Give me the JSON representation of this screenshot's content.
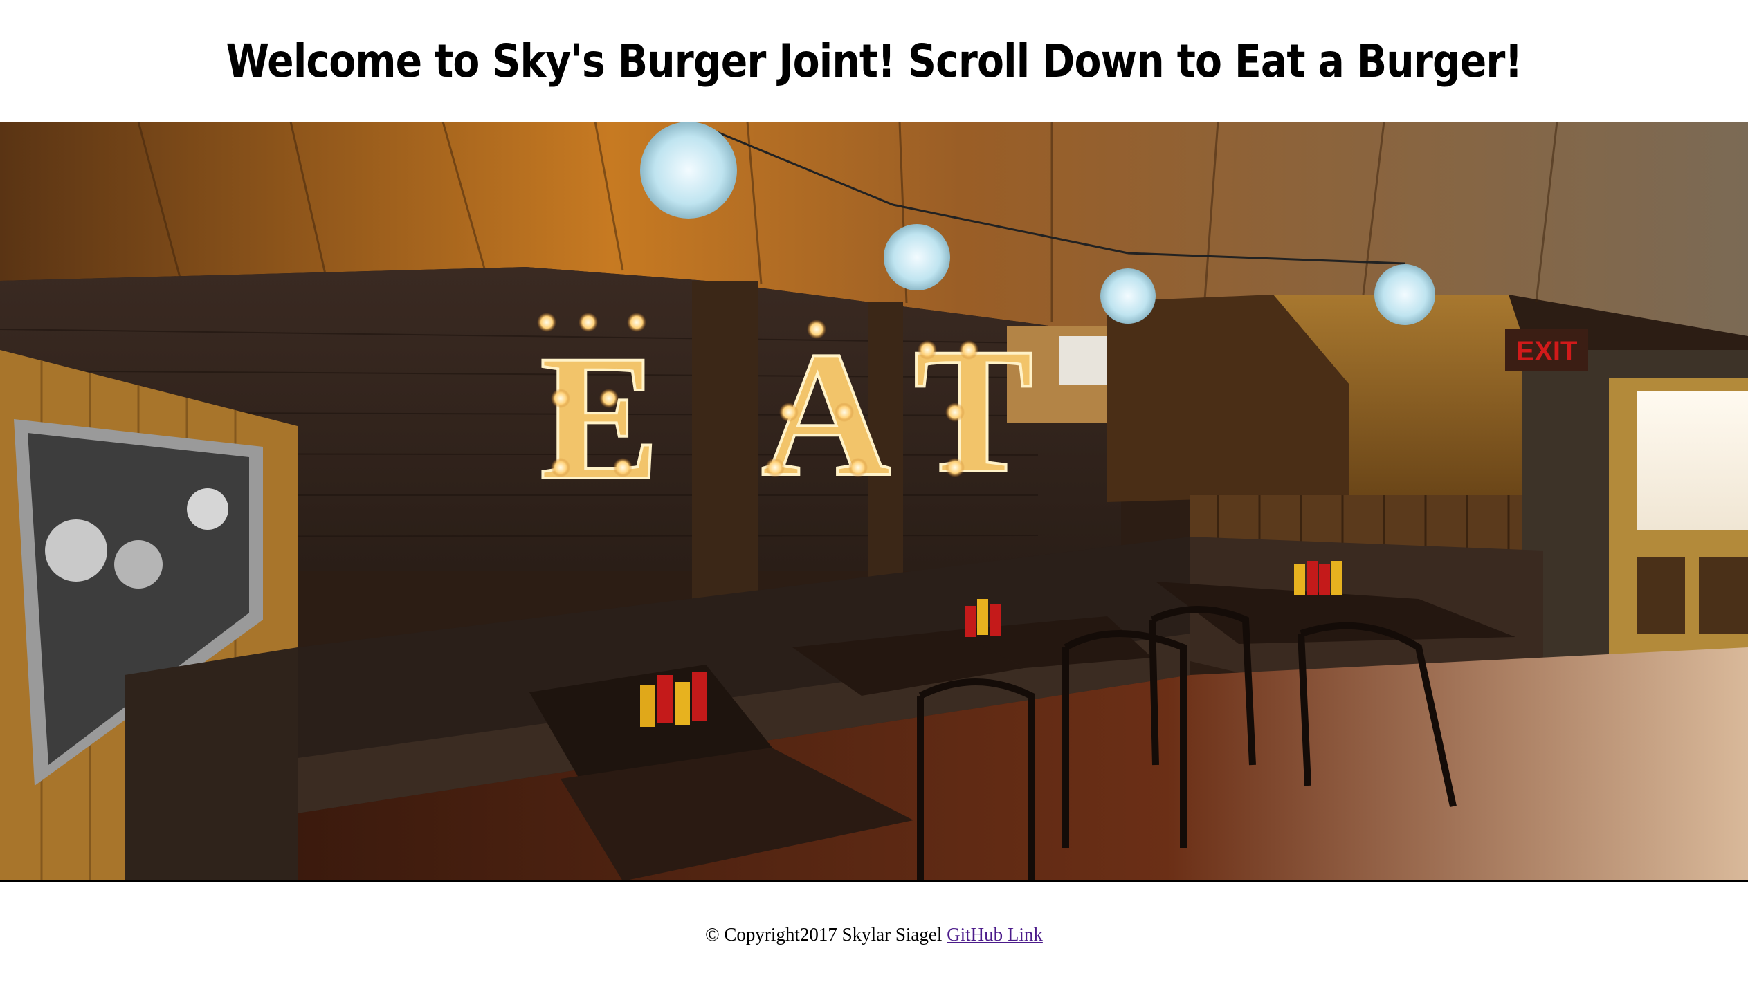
{
  "header": {
    "title": "Welcome to Sky's Burger Joint! Scroll Down to Eat a Burger!"
  },
  "hero": {
    "sign_letters": [
      "E",
      "A",
      "T"
    ],
    "exit_sign": "EXIT"
  },
  "footer": {
    "copyright": "© Copyright2017 Skylar Siagel",
    "github_link": "GitHub Link"
  },
  "colors": {
    "background": "#ffffff",
    "text": "#000000",
    "link": "#4b1b8a",
    "exit_sign": "#d11a1a"
  }
}
